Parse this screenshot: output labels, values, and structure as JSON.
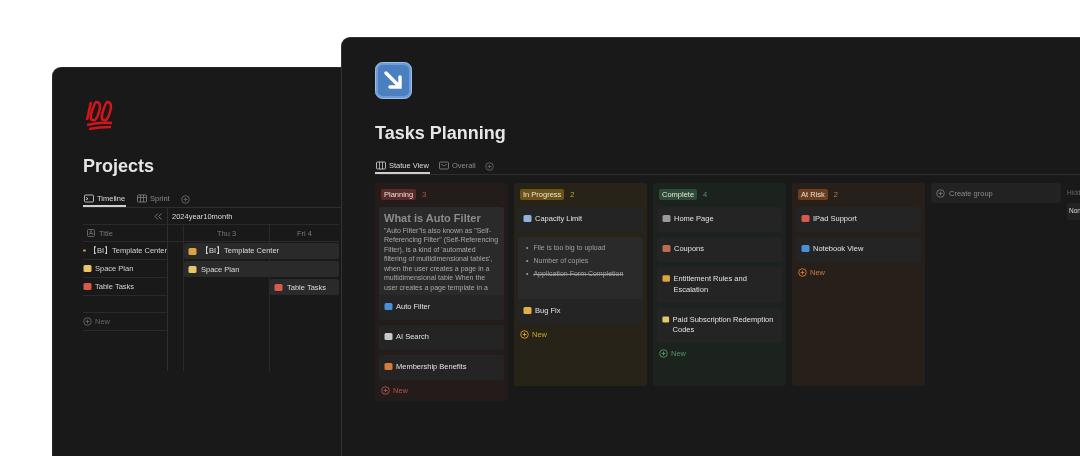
{
  "projects_window": {
    "title": "Projects",
    "tabs": [
      {
        "label": "Timeline",
        "selected": true
      },
      {
        "label": "Sprint",
        "selected": false
      }
    ],
    "timeline": {
      "month": "2024year10month",
      "title_header": "Title",
      "rows": [
        {
          "title": "【BI】Template Center"
        },
        {
          "title": "Space Plan"
        },
        {
          "title": "Table Tasks"
        }
      ],
      "days": [
        {
          "label": "Thu 3",
          "bars": [
            {
              "title": "【BI】Template Center"
            },
            {
              "title": "Space Plan"
            }
          ]
        },
        {
          "label": "Fri 4",
          "bars": [
            {
              "title": "Table Tasks"
            }
          ]
        }
      ],
      "new_label": "New"
    }
  },
  "tasks_window": {
    "title": "Tasks Planning",
    "tabs": [
      {
        "label": "Statue View",
        "selected": true
      },
      {
        "label": "Overall",
        "selected": false
      }
    ],
    "groups": [
      {
        "name": "Planning",
        "count": "3",
        "color": "#5a2a28",
        "new_label": "New",
        "cards": [
          {
            "kind": "preview",
            "preview_title": "What is Auto Filter",
            "preview_text": "\"Auto Filter\"is also known as \"Self-Referencing Filter\" (Self-Referencing Filter), is a kind of 'automated filtering of multidimensional tables', when the user creates a page in a multidimensional table When the user creates a page template in a",
            "title": "Auto Filter"
          },
          {
            "kind": "plain",
            "title": "AI Search"
          },
          {
            "kind": "plain",
            "title": "Membership Benefits"
          }
        ]
      },
      {
        "name": "In Progress",
        "count": "2",
        "color": "#6b5316",
        "new_label": "New",
        "cards": [
          {
            "kind": "plain",
            "title": "Capacity Limit"
          },
          {
            "kind": "checklist",
            "items": [
              {
                "bullet": "•",
                "text": "File is too big to upload",
                "done": false
              },
              {
                "bullet": "•",
                "text": "Number of copies",
                "done": false
              },
              {
                "bullet": "•",
                "text": "Application Form Completion",
                "done": true
              }
            ],
            "title": "Bug Fix"
          }
        ]
      },
      {
        "name": "Complete",
        "count": "4",
        "color": "#2c4b36",
        "new_label": "New",
        "cards": [
          {
            "kind": "plain",
            "title": "Home Page"
          },
          {
            "kind": "plain",
            "title": "Coupons"
          },
          {
            "kind": "plain",
            "title": "Entitlement Rules and Escalation"
          },
          {
            "kind": "plain",
            "title": "Paid Subscription Redemption Codes"
          }
        ]
      },
      {
        "name": "At Risk",
        "count": "2",
        "color": "#6b3e1d",
        "new_label": "New",
        "cards": [
          {
            "kind": "plain",
            "title": "IPad Support"
          },
          {
            "kind": "plain",
            "title": "Notebook View"
          }
        ]
      }
    ],
    "create_group": "Create group",
    "hidden": {
      "title": "Hidd",
      "items": [
        "Non"
      ]
    }
  }
}
